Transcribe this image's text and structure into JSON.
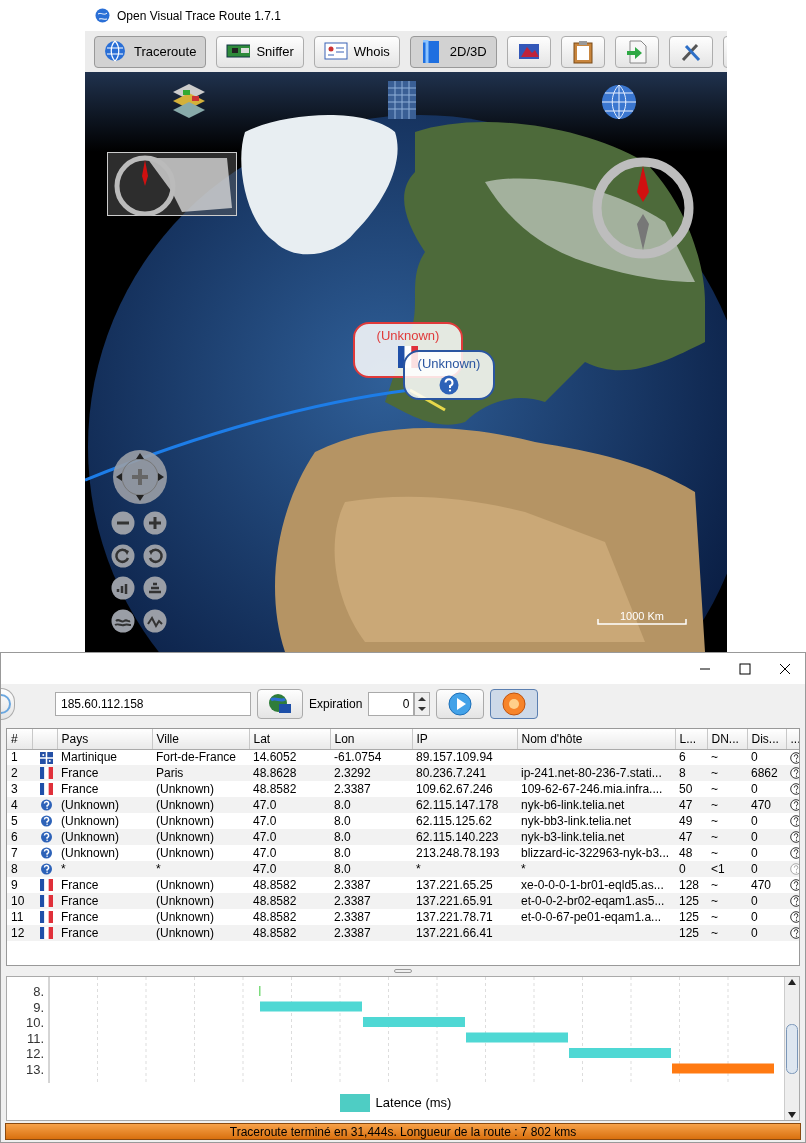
{
  "main_window": {
    "title": "Open Visual Trace Route 1.7.1",
    "toolbar": [
      {
        "kind": "labeled",
        "label": "Traceroute",
        "pressed": true
      },
      {
        "kind": "labeled",
        "label": "Sniffer",
        "pressed": false
      },
      {
        "kind": "labeled",
        "label": "Whois",
        "pressed": false
      },
      {
        "kind": "labeled",
        "label": "2D/3D",
        "pressed": true
      },
      {
        "kind": "icon",
        "pressed": false
      },
      {
        "kind": "icon",
        "pressed": false
      },
      {
        "kind": "icon",
        "pressed": false
      },
      {
        "kind": "icon",
        "pressed": false
      },
      {
        "kind": "icon",
        "pressed": false
      }
    ]
  },
  "map_view": {
    "labels": [
      {
        "text": "(Unknown)",
        "color": "#e03a3a",
        "kind": "france"
      },
      {
        "text": "(Unknown)",
        "color": "#2a55a0",
        "kind": "unknown"
      }
    ],
    "scale": "1000 Km"
  },
  "trace_window": {
    "address": "185.60.112.158",
    "expiration_label": "Expiration",
    "expiration": "0",
    "trace_pressed": false,
    "stop_pressed": true
  },
  "results": {
    "columns": [
      "#",
      "Pays",
      "Ville",
      "Lat",
      "Lon",
      "IP",
      "Nom d'hôte",
      "L...",
      "DN...",
      "Dis...",
      "..."
    ],
    "rows": [
      {
        "n": "1",
        "kind": "martinique",
        "pays": "Martinique",
        "ville": "Fort-de-France",
        "lat": "14.6052",
        "lon": "-61.0754",
        "ip": "89.157.109.94",
        "l": "6",
        "dn": "~",
        "dis": "0",
        "info_disabled": false
      },
      {
        "n": "2",
        "kind": "france",
        "pays": "France",
        "ville": "Paris",
        "lat": "48.8628",
        "lon": "2.3292",
        "ip": "80.236.7.241",
        "host": "ip-241.net-80-236-7.stati...",
        "l": "8",
        "dn": "~",
        "dis": "6862",
        "info_disabled": false
      },
      {
        "n": "3",
        "kind": "france",
        "pays": "France",
        "ville": "(Unknown)",
        "lat": "48.8582",
        "lon": "2.3387",
        "ip": "109.62.67.246",
        "host": "109-62-67-246.mia.infra....",
        "l": "50",
        "dn": "~",
        "dis": "0",
        "info_disabled": false
      },
      {
        "n": "4",
        "kind": "unknown",
        "pays": "(Unknown)",
        "ville": "(Unknown)",
        "lat": "47.0",
        "lon": "8.0",
        "ip": "62.115.147.178",
        "host": "nyk-b6-link.telia.net",
        "l": "47",
        "dn": "~",
        "dis": "470",
        "info_disabled": false
      },
      {
        "n": "5",
        "kind": "unknown",
        "pays": "(Unknown)",
        "ville": "(Unknown)",
        "lat": "47.0",
        "lon": "8.0",
        "ip": "62.115.125.62",
        "host": "nyk-bb3-link.telia.net",
        "l": "49",
        "dn": "~",
        "dis": "0",
        "info_disabled": false
      },
      {
        "n": "6",
        "kind": "unknown",
        "pays": "(Unknown)",
        "ville": "(Unknown)",
        "lat": "47.0",
        "lon": "8.0",
        "ip": "62.115.140.223",
        "host": "nyk-b3-link.telia.net",
        "l": "47",
        "dn": "~",
        "dis": "0",
        "info_disabled": false
      },
      {
        "n": "7",
        "kind": "unknown",
        "pays": "(Unknown)",
        "ville": "(Unknown)",
        "lat": "47.0",
        "lon": "8.0",
        "ip": "213.248.78.193",
        "host": "blizzard-ic-322963-nyk-b3...",
        "l": "48",
        "dn": "~",
        "dis": "0",
        "info_disabled": false
      },
      {
        "n": "8",
        "kind": "unknown",
        "pays": "*",
        "ville": "*",
        "lat": "47.0",
        "lon": "8.0",
        "ip": "*",
        "host": "*",
        "l": "0",
        "dn": "<1",
        "dis": "0",
        "info_disabled": true
      },
      {
        "n": "9",
        "kind": "france",
        "pays": "France",
        "ville": "(Unknown)",
        "lat": "48.8582",
        "lon": "2.3387",
        "ip": "137.221.65.25",
        "host": "xe-0-0-0-1-br01-eqld5.as...",
        "l": "128",
        "dn": "~",
        "dis": "470",
        "info_disabled": false
      },
      {
        "n": "10",
        "kind": "france",
        "pays": "France",
        "ville": "(Unknown)",
        "lat": "48.8582",
        "lon": "2.3387",
        "ip": "137.221.65.91",
        "host": "et-0-0-2-br02-eqam1.as5...",
        "l": "125",
        "dn": "~",
        "dis": "0",
        "info_disabled": false
      },
      {
        "n": "11",
        "kind": "france",
        "pays": "France",
        "ville": "(Unknown)",
        "lat": "48.8582",
        "lon": "2.3387",
        "ip": "137.221.78.71",
        "host": "et-0-0-67-pe01-eqam1.a...",
        "l": "125",
        "dn": "~",
        "dis": "0",
        "info_disabled": false
      },
      {
        "n": "12",
        "kind": "france",
        "pays": "France",
        "ville": "(Unknown)",
        "lat": "48.8582",
        "lon": "2.3387",
        "ip": "137.221.66.41",
        "l": "125",
        "dn": "~",
        "dis": "0",
        "info_disabled": false
      }
    ]
  },
  "chart": {
    "hops": [
      {
        "label": "8.",
        "color": "#7ddc7d"
      },
      {
        "label": "9.",
        "color": "#4fd8d4"
      },
      {
        "label": "10.",
        "color": "#4fd8d4"
      },
      {
        "label": "11.",
        "color": "#4fd8d4"
      },
      {
        "label": "12.",
        "color": "#4fd8d4"
      },
      {
        "label": "13.",
        "color": "#ff7a12"
      }
    ],
    "legend": {
      "label": "Latence (ms)",
      "color": "#4ecdc4"
    }
  },
  "status_bar": "Traceroute terminé en 31,444s. Longueur de la route : 7 802 kms"
}
